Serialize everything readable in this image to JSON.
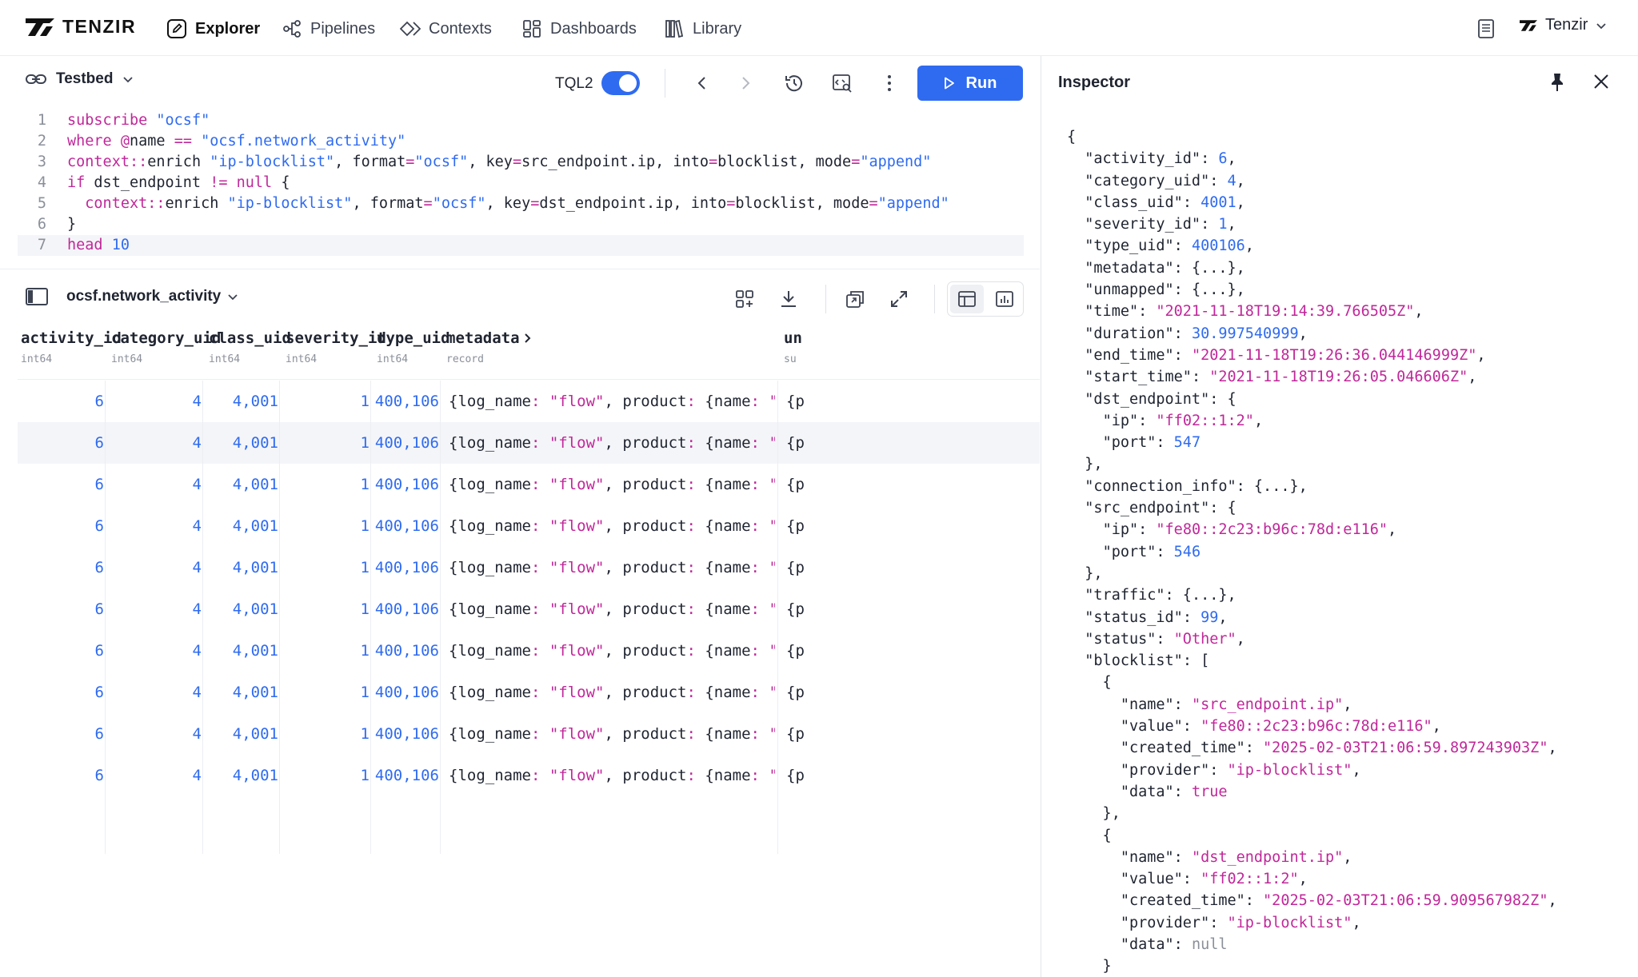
{
  "app": {
    "logo_text": "TENZIR",
    "nav": [
      {
        "label": "Explorer",
        "icon": "edit-icon",
        "active": true
      },
      {
        "label": "Pipelines",
        "icon": "pipeline-icon",
        "active": false
      },
      {
        "label": "Contexts",
        "icon": "contexts-icon",
        "active": false
      },
      {
        "label": "Dashboards",
        "icon": "dashboard-icon",
        "active": false
      },
      {
        "label": "Library",
        "icon": "library-icon",
        "active": false
      }
    ],
    "account_name": "Tenzir"
  },
  "editor": {
    "workspace": "Testbed",
    "language_label": "TQL2",
    "language_toggle_on": true,
    "run_label": "Run",
    "lines": [
      {
        "n": "1",
        "text": "subscribe \"ocsf\""
      },
      {
        "n": "2",
        "text": "where @name == \"ocsf.network_activity\""
      },
      {
        "n": "3",
        "text": "context::enrich \"ip-blocklist\", format=\"ocsf\", key=src_endpoint.ip, into=blocklist, mode=\"append\""
      },
      {
        "n": "4",
        "text": "if dst_endpoint != null {"
      },
      {
        "n": "5",
        "text": "  context::enrich \"ip-blocklist\", format=\"ocsf\", key=dst_endpoint.ip, into=blocklist, mode=\"append\""
      },
      {
        "n": "6",
        "text": "}"
      },
      {
        "n": "7",
        "text": "head 10"
      }
    ],
    "current_line": 7
  },
  "results": {
    "schema_name": "ocsf.network_activity",
    "columns": [
      {
        "name": "activity_id",
        "type": "int64"
      },
      {
        "name": "category_uid",
        "type": "int64"
      },
      {
        "name": "class_uid",
        "type": "int64"
      },
      {
        "name": "severity_id",
        "type": "int64"
      },
      {
        "name": "type_uid",
        "type": "int64"
      },
      {
        "name": "metadata",
        "type": "record"
      },
      {
        "name": "un",
        "type": "su"
      }
    ],
    "rows": [
      {
        "activity_id": "6",
        "category_uid": "4",
        "class_uid": "4,001",
        "severity_id": "1",
        "type_uid": "400,106",
        "metadata": "{log_name: \"flow\", product: {name: \"Suricata\",",
        "next": "{p"
      },
      {
        "activity_id": "6",
        "category_uid": "4",
        "class_uid": "4,001",
        "severity_id": "1",
        "type_uid": "400,106",
        "metadata": "{log_name: \"flow\", product: {name: \"Suricata\",",
        "next": "{p"
      },
      {
        "activity_id": "6",
        "category_uid": "4",
        "class_uid": "4,001",
        "severity_id": "1",
        "type_uid": "400,106",
        "metadata": "{log_name: \"flow\", product: {name: \"Suricata\",",
        "next": "{p"
      },
      {
        "activity_id": "6",
        "category_uid": "4",
        "class_uid": "4,001",
        "severity_id": "1",
        "type_uid": "400,106",
        "metadata": "{log_name: \"flow\", product: {name: \"Suricata\",",
        "next": "{p"
      },
      {
        "activity_id": "6",
        "category_uid": "4",
        "class_uid": "4,001",
        "severity_id": "1",
        "type_uid": "400,106",
        "metadata": "{log_name: \"flow\", product: {name: \"Suricata\",",
        "next": "{p"
      },
      {
        "activity_id": "6",
        "category_uid": "4",
        "class_uid": "4,001",
        "severity_id": "1",
        "type_uid": "400,106",
        "metadata": "{log_name: \"flow\", product: {name: \"Suricata\",",
        "next": "{p"
      },
      {
        "activity_id": "6",
        "category_uid": "4",
        "class_uid": "4,001",
        "severity_id": "1",
        "type_uid": "400,106",
        "metadata": "{log_name: \"flow\", product: {name: \"Suricata\",",
        "next": "{p"
      },
      {
        "activity_id": "6",
        "category_uid": "4",
        "class_uid": "4,001",
        "severity_id": "1",
        "type_uid": "400,106",
        "metadata": "{log_name: \"flow\", product: {name: \"Suricata\",",
        "next": "{p"
      },
      {
        "activity_id": "6",
        "category_uid": "4",
        "class_uid": "4,001",
        "severity_id": "1",
        "type_uid": "400,106",
        "metadata": "{log_name: \"flow\", product: {name: \"Suricata\",",
        "next": "{p"
      },
      {
        "activity_id": "6",
        "category_uid": "4",
        "class_uid": "4,001",
        "severity_id": "1",
        "type_uid": "400,106",
        "metadata": "{log_name: \"flow\", product: {name: \"Suricata\",",
        "next": "{p"
      }
    ],
    "highlighted_row": 2
  },
  "inspector": {
    "title": "Inspector",
    "lines": [
      "{",
      "  \"activity_id\": 6,",
      "  \"category_uid\": 4,",
      "  \"class_uid\": 4001,",
      "  \"severity_id\": 1,",
      "  \"type_uid\": 400106,",
      "  \"metadata\": {...},",
      "  \"unmapped\": {...},",
      "  \"time\": \"2021-11-18T19:14:39.766505Z\",",
      "  \"duration\": 30.997540999,",
      "  \"end_time\": \"2021-11-18T19:26:36.044146999Z\",",
      "  \"start_time\": \"2021-11-18T19:26:05.046606Z\",",
      "  \"dst_endpoint\": {",
      "    \"ip\": \"ff02::1:2\",",
      "    \"port\": 547",
      "  },",
      "  \"connection_info\": {...},",
      "  \"src_endpoint\": {",
      "    \"ip\": \"fe80::2c23:b96c:78d:e116\",",
      "    \"port\": 546",
      "  },",
      "  \"traffic\": {...},",
      "  \"status_id\": 99,",
      "  \"status\": \"Other\",",
      "  \"blocklist\": [",
      "    {",
      "      \"name\": \"src_endpoint.ip\",",
      "      \"value\": \"fe80::2c23:b96c:78d:e116\",",
      "      \"created_time\": \"2025-02-03T21:06:59.897243903Z\",",
      "      \"provider\": \"ip-blocklist\",",
      "      \"data\": true",
      "    },",
      "    {",
      "      \"name\": \"dst_endpoint.ip\",",
      "      \"value\": \"ff02::1:2\",",
      "      \"created_time\": \"2025-02-03T21:06:59.909567982Z\",",
      "      \"provider\": \"ip-blocklist\",",
      "      \"data\": null",
      "    }"
    ]
  },
  "colors": {
    "accent": "#2f6bf0",
    "keyword": "#c0289a",
    "muted": "#8a8f99"
  }
}
